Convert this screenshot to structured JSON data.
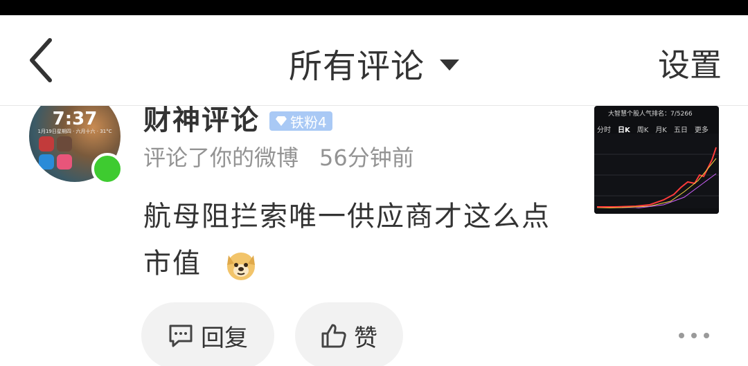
{
  "nav": {
    "title": "所有评论",
    "settings_label": "设置"
  },
  "comment": {
    "username": "财神评论",
    "badge_label": "铁粉4",
    "action_text": "评论了你的微博",
    "time_ago": "56分钟前",
    "text": "航母阻拦索唯一供应商才这么点市值",
    "emoji": "doge-emoji"
  },
  "avatar": {
    "time": "7:37",
    "subtitle": "1月19日星期四 · 六月十六 · 31°C",
    "online": true
  },
  "thumbnail": {
    "header": "大智慧个股人气排名：7/5266",
    "tabs": [
      "分时",
      "日K",
      "周K",
      "月K",
      "五日",
      "更多"
    ],
    "active_tab": "日K"
  },
  "actions": {
    "reply_label": "回复",
    "like_label": "赞"
  },
  "colors": {
    "status_bar": "#000000",
    "online": "#3ecb30",
    "badge": "#a9c9f5",
    "pill_bg": "#f2f2f2",
    "meta_text": "#939393"
  },
  "icons": [
    "back-icon",
    "dropdown-triangle-icon",
    "diamond-icon",
    "doge-emoji",
    "comment-icon",
    "thumbs-up-icon",
    "more-dots-icon"
  ]
}
